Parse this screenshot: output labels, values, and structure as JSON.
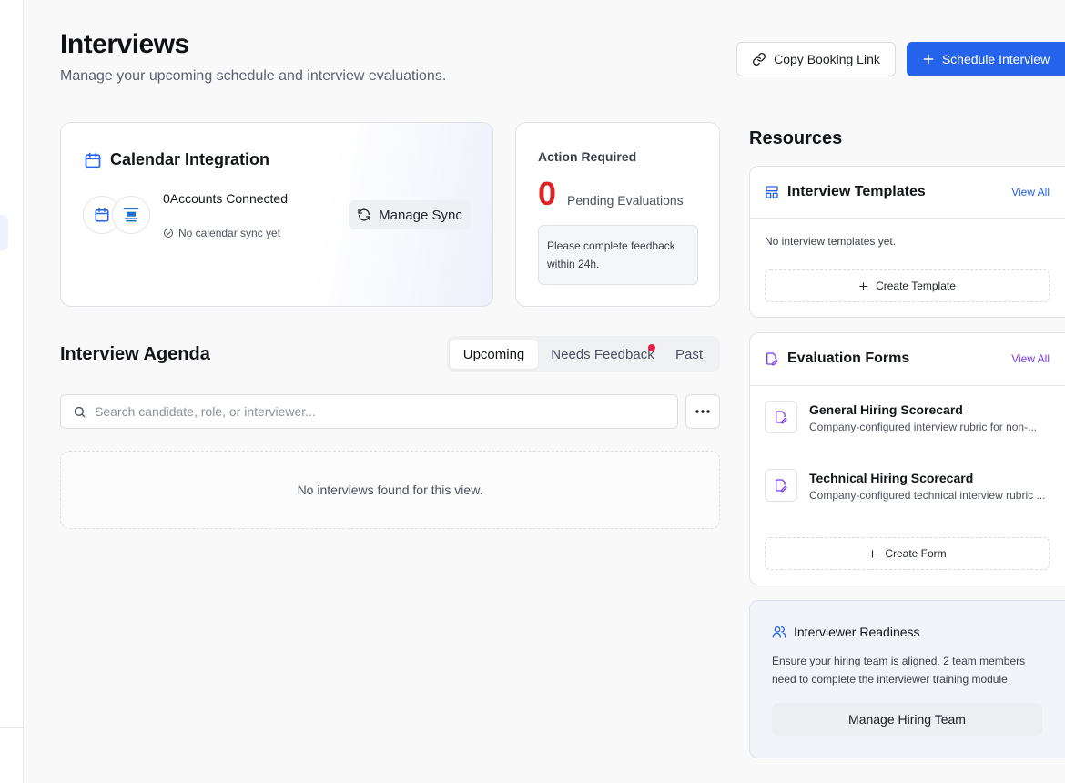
{
  "header": {
    "title": "Interviews",
    "subtitle": "Manage your upcoming schedule and interview evaluations.",
    "copy_link_label": "Copy Booking Link",
    "schedule_label": "Schedule Interview"
  },
  "calendar": {
    "title": "Calendar Integration",
    "accounts_text": "0Accounts Connected",
    "sync_status": "No calendar sync yet",
    "manage_sync_label": "Manage Sync"
  },
  "action": {
    "label": "Action Required",
    "count": "0",
    "pending_label": "Pending Evaluations",
    "note": "Please complete feedback within 24h."
  },
  "agenda": {
    "title": "Interview Agenda",
    "tabs": [
      {
        "label": "Upcoming",
        "active": true
      },
      {
        "label": "Needs Feedback",
        "active": false,
        "has_dot": true
      },
      {
        "label": "Past",
        "active": false
      }
    ],
    "search_placeholder": "Search candidate, role, or interviewer...",
    "empty_text": "No interviews found for this view."
  },
  "resources": {
    "title": "Resources",
    "templates": {
      "title": "Interview Templates",
      "view_all": "View All",
      "empty_text": "No interview templates yet.",
      "create_label": "Create Template"
    },
    "forms": {
      "title": "Evaluation Forms",
      "view_all": "View All",
      "items": [
        {
          "name": "General Hiring Scorecard",
          "desc": "Company-configured interview rubric for non-..."
        },
        {
          "name": "Technical Hiring Scorecard",
          "desc": "Company-configured technical interview rubric ..."
        }
      ],
      "create_label": "Create Form"
    },
    "readiness": {
      "title": "Interviewer Readiness",
      "text": "Ensure your hiring team is aligned. 2 team members need to complete the interviewer training module.",
      "button_label": "Manage Hiring Team"
    }
  },
  "colors": {
    "primary": "#2563eb",
    "danger": "#dc2626",
    "templates_accent": "#2563eb",
    "forms_accent": "#7c3aed"
  }
}
